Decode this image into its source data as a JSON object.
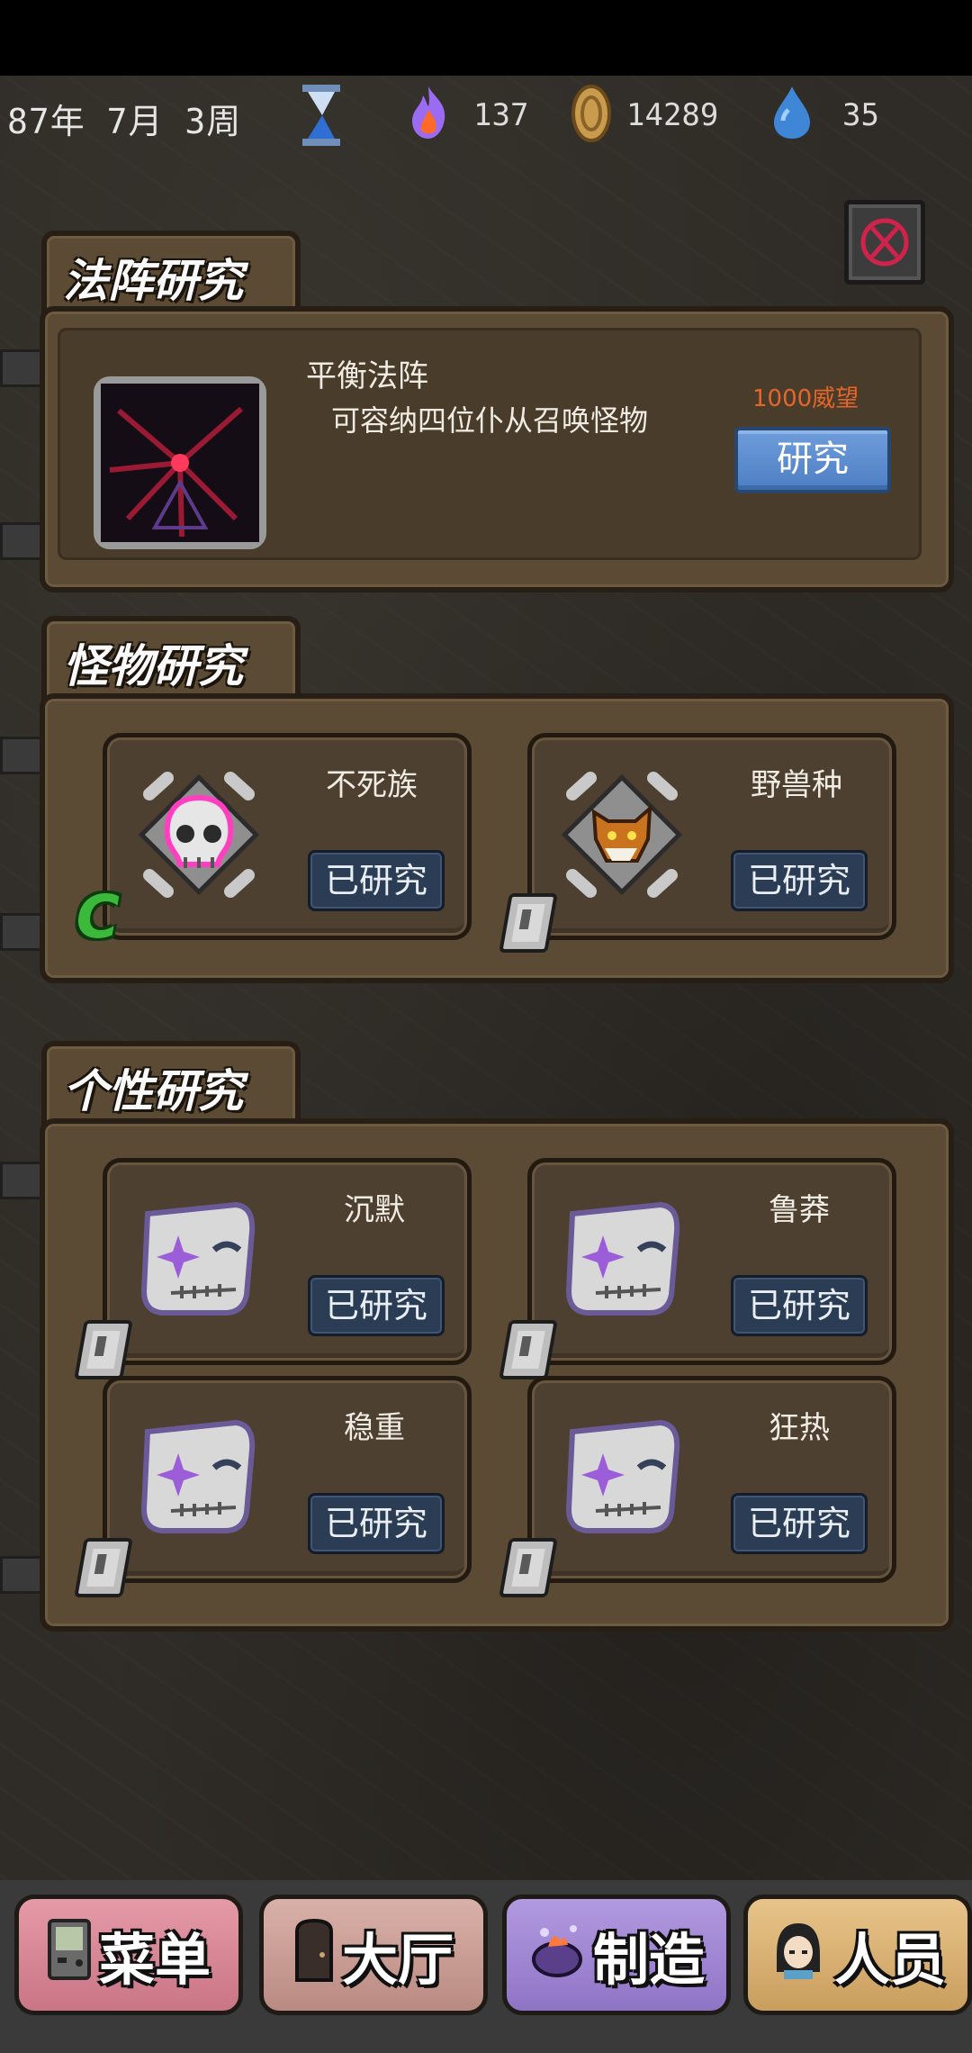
{
  "hud": {
    "date_text": "87年 7月 3周",
    "resources": [
      {
        "name": "flame-icon",
        "value": "137",
        "color": "#a06cff"
      },
      {
        "name": "coin-icon",
        "value": "14289",
        "color": "#c99b4e"
      },
      {
        "name": "water-drop-icon",
        "value": "35",
        "color": "#4a8fd8"
      }
    ]
  },
  "array_section": {
    "title": "法阵研究",
    "item": {
      "name": "平衡法阵",
      "description": "可容纳四位仆从召唤怪物",
      "cost": "1000威望",
      "button_label": "研究"
    }
  },
  "monster_section": {
    "title": "怪物研究",
    "items": [
      {
        "name": "不死族",
        "button_label": "已研究",
        "rank": "C",
        "icon": "skull-emblem-icon"
      },
      {
        "name": "野兽种",
        "button_label": "已研究",
        "rank": "D",
        "icon": "wolf-emblem-icon"
      }
    ]
  },
  "trait_section": {
    "title": "个性研究",
    "items": [
      {
        "name": "沉默",
        "button_label": "已研究",
        "rank": "D",
        "icon": "stitched-mask-icon"
      },
      {
        "name": "鲁莽",
        "button_label": "已研究",
        "rank": "D",
        "icon": "stitched-mask-icon"
      },
      {
        "name": "稳重",
        "button_label": "已研究",
        "rank": "D",
        "icon": "stitched-mask-icon"
      },
      {
        "name": "狂热",
        "button_label": "已研究",
        "rank": "D",
        "icon": "stitched-mask-icon"
      }
    ]
  },
  "bottom_nav": [
    {
      "label": "菜单",
      "icon": "handheld-device-icon",
      "color": "#d98a9a"
    },
    {
      "label": "大厅",
      "icon": "door-icon",
      "color": "#cda19a"
    },
    {
      "label": "制造",
      "icon": "cauldron-icon",
      "color": "#a68ad6"
    },
    {
      "label": "人员",
      "icon": "person-portrait-icon",
      "color": "#d9b477"
    }
  ],
  "colors": {
    "panel_brown": "#5b4a34",
    "button_blue": "#4d7fc4",
    "done_button_navy": "#2b3d54",
    "cost_text_orange": "#e4662b"
  }
}
